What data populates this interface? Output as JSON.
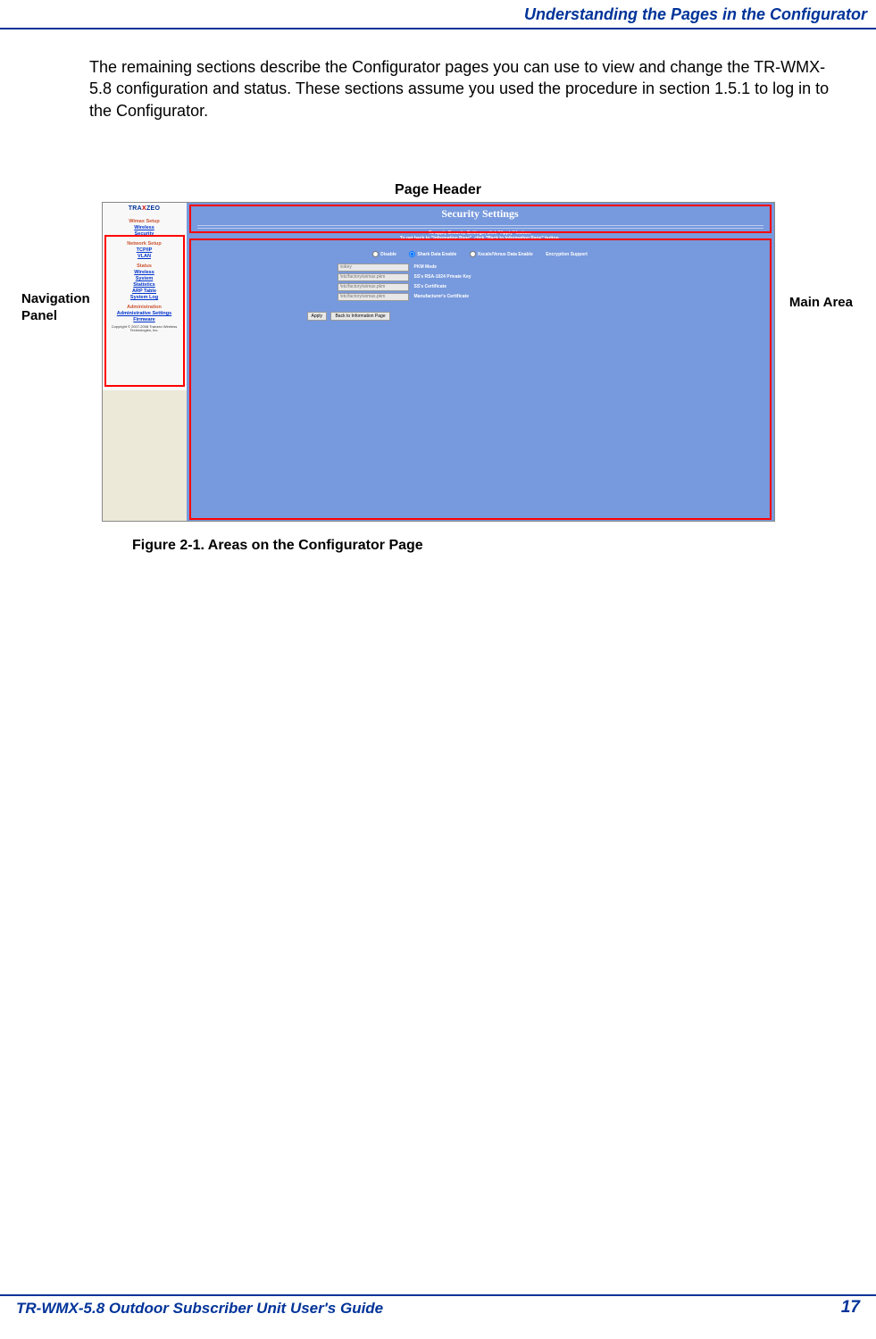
{
  "header": {
    "title": "Understanding the Pages in the Configurator"
  },
  "body": {
    "paragraph": "The remaining sections describe the Configurator pages you can use to view and change the TR-WMX-5.8 configuration and status. These sections assume you used the procedure in section 1.5.1 to log in to the Configurator."
  },
  "figure": {
    "page_header_label": "Page Header",
    "nav_label": "Navigation Panel",
    "main_label": "Main Area",
    "caption": "Figure 2-1. Areas on the Configurator Page"
  },
  "screenshot": {
    "logo": {
      "pre": "TRA",
      "mid": "X",
      "post": "ZEO"
    },
    "nav": {
      "wimax": "Wimax Setup",
      "wireless1": "Wireless",
      "security": "Security",
      "network": "Network Setup",
      "tcpip": "TCP/IP",
      "vlan": "VLAN",
      "status": "Status",
      "wireless2": "Wireless",
      "system": "System",
      "statistics": "Statistics",
      "arp": "ARP Table",
      "syslog": "System Log",
      "admin": "Administration",
      "adminset": "Administrative Settings",
      "firmware": "Firmware",
      "copyright": "Copyright © 2007-2008 Tranzeo Wireless Technologies, Inc."
    },
    "main": {
      "title": "Security Settings",
      "instr1": "To apply Security Settings, click \"Apply\" button.",
      "instr2": "To get back to \"Information Page\", click \"Back to Information Page\" button.",
      "opt_disable": "Disable",
      "opt_shark": "Shark Data Enable",
      "opt_xscale": "Xscale/Venus Data Enable",
      "col_enc": "Encryption Support",
      "rows": [
        {
          "inp": "nokey",
          "lab": "PKM Mode"
        },
        {
          "inp": "/etc/factory/wimax.pkm",
          "lab": "SS's RSA-1024 Private Key"
        },
        {
          "inp": "/etc/factory/wimax.pkm",
          "lab": "SS's Certificate"
        },
        {
          "inp": "/etc/factory/wimax.pkm",
          "lab": "Manufacturer's Certificate"
        }
      ],
      "btn_apply": "Apply",
      "btn_back": "Back to Information Page"
    }
  },
  "footer": {
    "text": "TR-WMX-5.8 Outdoor Subscriber Unit User's Guide",
    "page": "17"
  }
}
